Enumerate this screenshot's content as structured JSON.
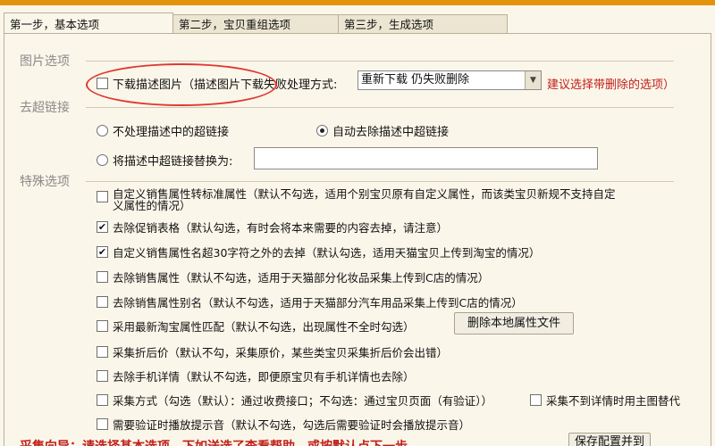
{
  "tabs": [
    {
      "label": "第一步，基本选项"
    },
    {
      "label": "第二步，宝贝重组选项"
    },
    {
      "label": "第三步，生成选项"
    }
  ],
  "groups": {
    "picture": "图片选项",
    "links": "去超链接",
    "special": "特殊选项"
  },
  "picture": {
    "download_label": "下载描述图片",
    "fail_label": "（描述图片下载失败处理方式:",
    "select_value": "重新下载 仍失败删除",
    "hint": "建议选择带删除的选项）"
  },
  "links": {
    "option_keep": "不处理描述中的超链接",
    "option_remove": "自动去除描述中超链接",
    "option_replace": "将描述中超链接替换为:",
    "replace_value": "",
    "selected": "option_remove"
  },
  "special": {
    "items": [
      {
        "label": "自定义销售属性转标准属性（默认不勾选，适用个别宝贝原有自定义属性，而该类宝贝新规不支持自定",
        "label2": "义属性的情况）",
        "checked": false
      },
      {
        "label": "去除促销表格（默认勾选，有时会将本来需要的内容去掉，请注意）",
        "checked": true
      },
      {
        "label": "自定义销售属性名超30字符之外的去掉（默认勾选，适用天猫宝贝上传到淘宝的情况）",
        "checked": true
      },
      {
        "label": "去除销售属性（默认不勾选，适用于天猫部分化妆品采集上传到C店的情况）",
        "checked": false
      },
      {
        "label": "去除销售属性别名（默认不勾选，适用于天猫部分汽车用品采集上传到C店的情况）",
        "checked": false
      },
      {
        "label": "采用最新淘宝属性匹配（默认不勾选，出现属性不全时勾选）",
        "checked": false,
        "button": "删除本地属性文件"
      },
      {
        "label": "采集折后价（默认不勾，采集原价，某些类宝贝采集折后价会出错）",
        "checked": false
      },
      {
        "label": "去除手机详情（默认不勾选，即便原宝贝有手机详情也去除）",
        "checked": false
      },
      {
        "label": "采集方式（勾选（默认）：通过收费接口；不勾选：通过宝贝页面（有验证））",
        "checked": false,
        "extra": "采集不到详情时用主图替代",
        "extra_checked": false
      },
      {
        "label": "需要验证时播放提示音（默认不勾选，勾选后需要验证时会播放提示音）",
        "checked": false
      }
    ]
  },
  "footer": {
    "warning": "采集向导：请选择基本选项，下如送选了查看帮助，或按默认点下一步。",
    "save_button": "保存配置并到"
  },
  "colors": {
    "accent": "#e2930b",
    "highlight": "#e0382f",
    "warning": "#c0201a"
  }
}
